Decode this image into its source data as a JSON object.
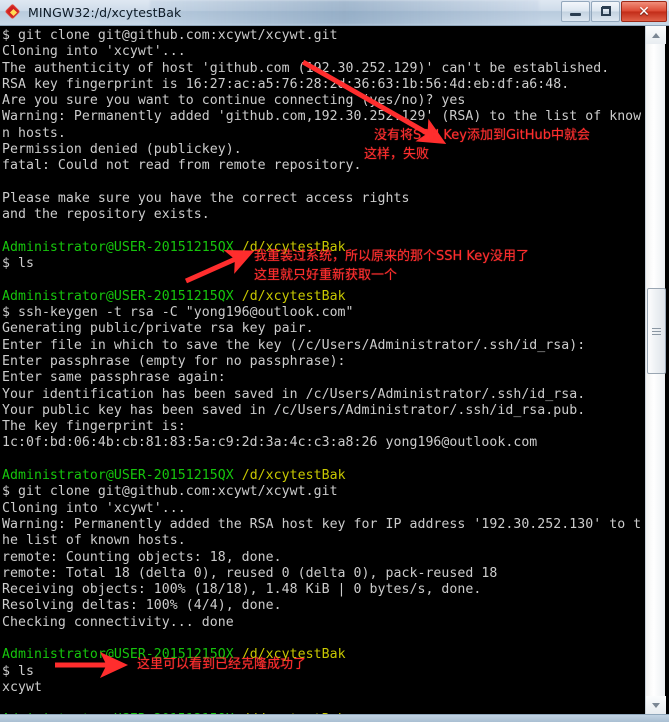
{
  "window": {
    "title": "MINGW32:/d/xcytestBak",
    "icon": "git-bash-diamond-icon",
    "buttons": {
      "minimize": "minimize-button",
      "maximize": "maximize-button",
      "close_glyph": "✕"
    }
  },
  "terminal": {
    "prompt_user": "Administrator@USER-20151215QX",
    "prompt_path": "/d/xcytestBak",
    "lines": [
      {
        "type": "text",
        "text": "$ git clone git@github.com:xcywt/xcywt.git"
      },
      {
        "type": "text",
        "text": "Cloning into 'xcywt'..."
      },
      {
        "type": "text",
        "text": "The authenticity of host 'github.com (192.30.252.129)' can't be established."
      },
      {
        "type": "text",
        "text": "RSA key fingerprint is 16:27:ac:a5:76:28:2d:36:63:1b:56:4d:eb:df:a6:48."
      },
      {
        "type": "text",
        "text": "Are you sure you want to continue connecting (yes/no)? yes"
      },
      {
        "type": "text",
        "text": "Warning: Permanently added 'github.com,192.30.252.129' (RSA) to the list of know"
      },
      {
        "type": "text",
        "text": "n hosts."
      },
      {
        "type": "text",
        "text": "Permission denied (publickey)."
      },
      {
        "type": "text",
        "text": "fatal: Could not read from remote repository."
      },
      {
        "type": "blank",
        "text": ""
      },
      {
        "type": "text",
        "text": "Please make sure you have the correct access rights"
      },
      {
        "type": "text",
        "text": "and the repository exists."
      },
      {
        "type": "blank",
        "text": ""
      },
      {
        "type": "prompt",
        "text": ""
      },
      {
        "type": "text",
        "text": "$ ls"
      },
      {
        "type": "blank",
        "text": ""
      },
      {
        "type": "prompt",
        "text": ""
      },
      {
        "type": "text",
        "text": "$ ssh-keygen -t rsa -C \"yong196@outlook.com\""
      },
      {
        "type": "text",
        "text": "Generating public/private rsa key pair."
      },
      {
        "type": "text",
        "text": "Enter file in which to save the key (/c/Users/Administrator/.ssh/id_rsa):"
      },
      {
        "type": "text",
        "text": "Enter passphrase (empty for no passphrase):"
      },
      {
        "type": "text",
        "text": "Enter same passphrase again:"
      },
      {
        "type": "text",
        "text": "Your identification has been saved in /c/Users/Administrator/.ssh/id_rsa."
      },
      {
        "type": "text",
        "text": "Your public key has been saved in /c/Users/Administrator/.ssh/id_rsa.pub."
      },
      {
        "type": "text",
        "text": "The key fingerprint is:"
      },
      {
        "type": "text",
        "text": "1c:0f:bd:06:4b:cb:81:83:5a:c9:2d:3a:4c:c3:a8:26 yong196@outlook.com"
      },
      {
        "type": "blank",
        "text": ""
      },
      {
        "type": "prompt",
        "text": ""
      },
      {
        "type": "text",
        "text": "$ git clone git@github.com:xcywt/xcywt.git"
      },
      {
        "type": "text",
        "text": "Cloning into 'xcywt'..."
      },
      {
        "type": "text",
        "text": "Warning: Permanently added the RSA host key for IP address '192.30.252.130' to t"
      },
      {
        "type": "text",
        "text": "he list of known hosts."
      },
      {
        "type": "text",
        "text": "remote: Counting objects: 18, done."
      },
      {
        "type": "text",
        "text": "remote: Total 18 (delta 0), reused 0 (delta 0), pack-reused 18"
      },
      {
        "type": "text",
        "text": "Receiving objects: 100% (18/18), 1.48 KiB | 0 bytes/s, done."
      },
      {
        "type": "text",
        "text": "Resolving deltas: 100% (4/4), done."
      },
      {
        "type": "text",
        "text": "Checking connectivity... done"
      },
      {
        "type": "blank",
        "text": ""
      },
      {
        "type": "prompt",
        "text": ""
      },
      {
        "type": "text",
        "text": "$ ls"
      },
      {
        "type": "text",
        "text": "xcywt"
      },
      {
        "type": "blank",
        "text": ""
      },
      {
        "type": "prompt",
        "text": ""
      }
    ]
  },
  "annotations": [
    {
      "name": "annotation-ssh-key-not-added",
      "line1": "没有将SSH Key添加到GitHub中就会",
      "line2": "这样，失败",
      "color": "#ff2d2d"
    },
    {
      "name": "annotation-reinstalled-system",
      "line1": "我重装过系统，所以原来的那个SSH Key没用了",
      "line2": "这里就只好重新获取一个",
      "color": "#ff2d2d"
    },
    {
      "name": "annotation-clone-success",
      "line1": "这里可以看到已经克隆成功了",
      "line2": "",
      "color": "#ff2d2d"
    }
  ],
  "scrollbar": {
    "up_arrow": "scroll-up-arrow",
    "down_arrow": "scroll-down-arrow",
    "thumb": "scroll-thumb"
  }
}
